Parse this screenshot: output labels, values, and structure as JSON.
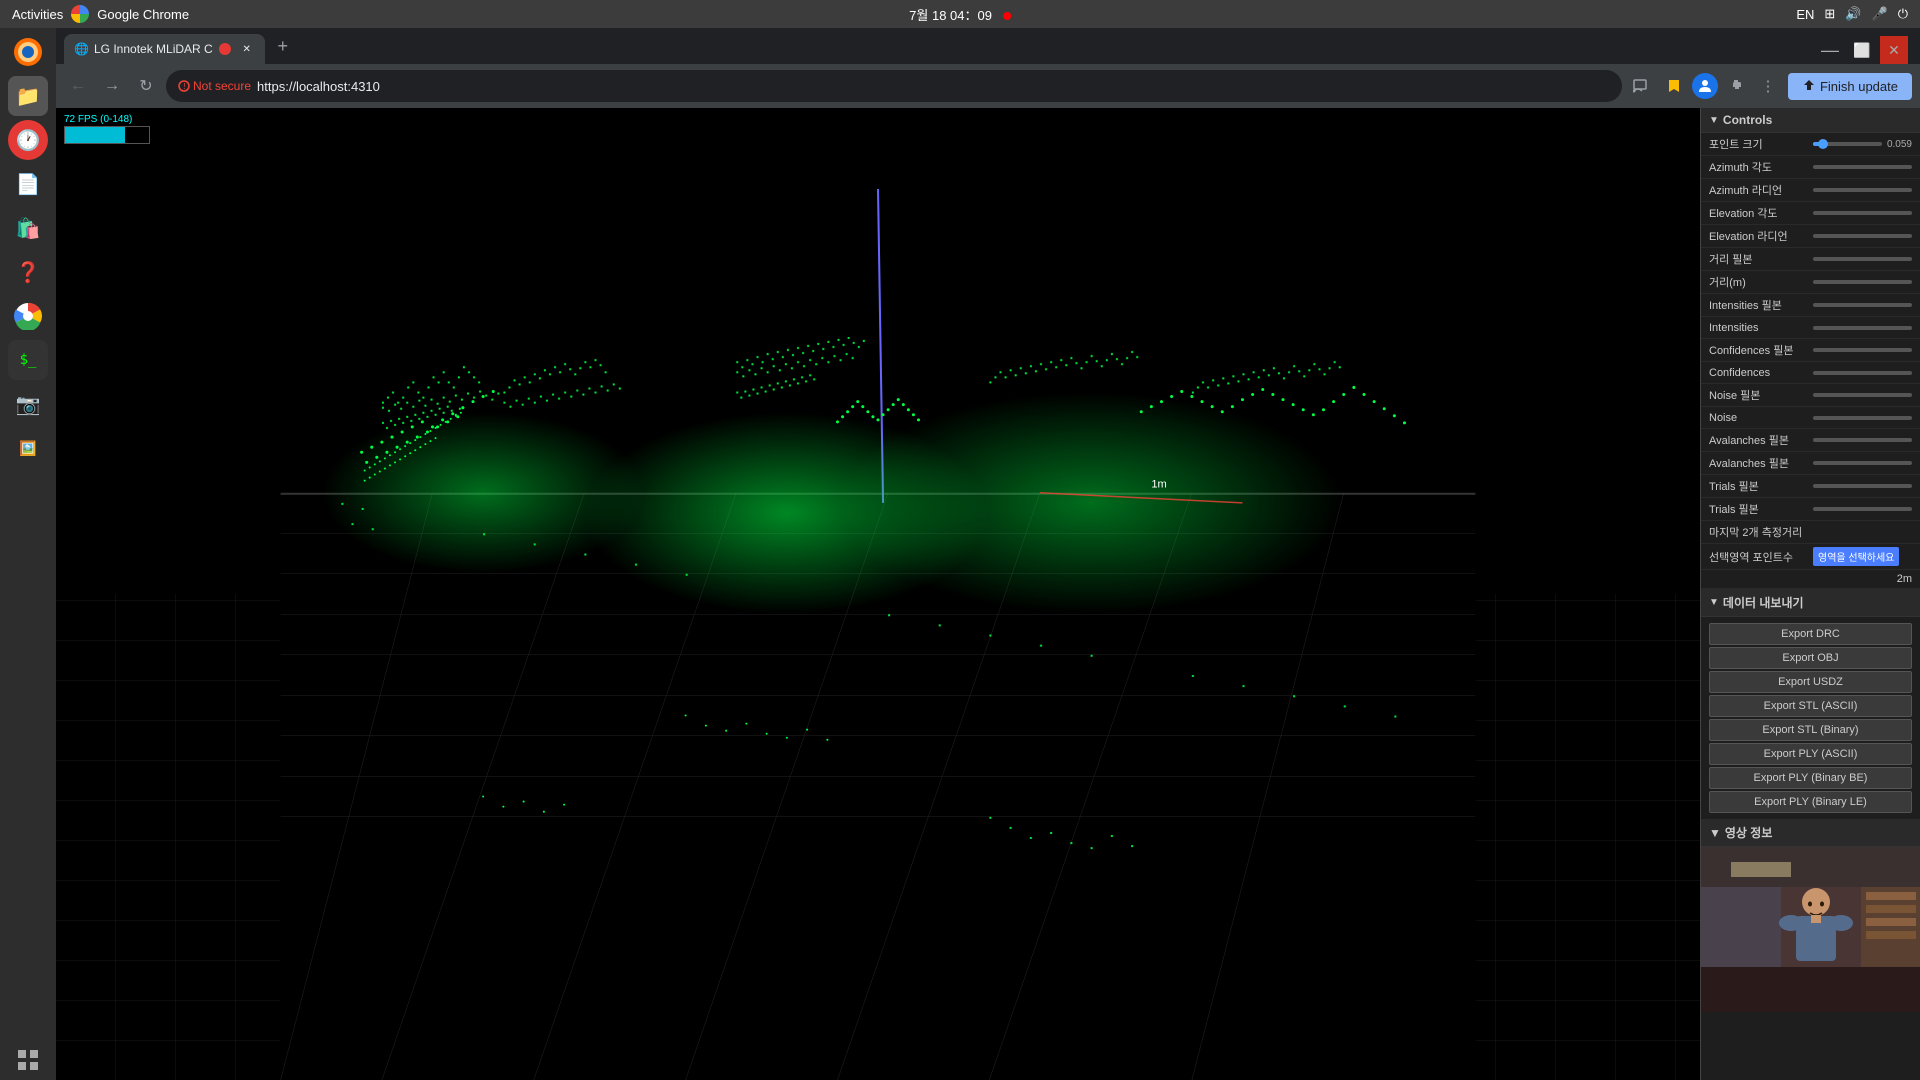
{
  "os": {
    "topbar_left": "Activities",
    "app_name": "Google Chrome",
    "datetime": "7월 18 04：09",
    "record_visible": true,
    "lang": "EN"
  },
  "browser": {
    "tab_title": "LG Innotek MLiDAR C",
    "tab_favicon": "🌐",
    "url": "https://localhost:4310",
    "not_secure_label": "Not secure",
    "finish_update_label": "Finish update",
    "new_tab_label": "+"
  },
  "viewport": {
    "fps_label": "72 FPS (0-148)",
    "distance_label": "1m",
    "distance_grid": "2m"
  },
  "controls": {
    "section_title": "Controls",
    "rows": [
      {
        "label": "포인트 크기",
        "has_slider": true,
        "fill_pct": 15,
        "value": "0.059"
      },
      {
        "label": "Azimuth 각도",
        "has_slider": true,
        "fill_pct": 0,
        "value": ""
      },
      {
        "label": "Azimuth 라디언",
        "has_slider": true,
        "fill_pct": 0,
        "value": ""
      },
      {
        "label": "Elevation 각도",
        "has_slider": true,
        "fill_pct": 0,
        "value": ""
      },
      {
        "label": "Elevation 라디언",
        "has_slider": true,
        "fill_pct": 0,
        "value": ""
      },
      {
        "label": "거리 필본",
        "has_slider": true,
        "fill_pct": 0,
        "value": ""
      },
      {
        "label": "거리(m)",
        "has_slider": true,
        "fill_pct": 0,
        "value": ""
      },
      {
        "label": "Intensities 필본",
        "has_slider": true,
        "fill_pct": 0,
        "value": ""
      },
      {
        "label": "Intensities",
        "has_slider": true,
        "fill_pct": 0,
        "value": ""
      },
      {
        "label": "Confidences 필본",
        "has_slider": true,
        "fill_pct": 0,
        "value": ""
      },
      {
        "label": "Confidences",
        "has_slider": true,
        "fill_pct": 0,
        "value": ""
      },
      {
        "label": "Noise 필본",
        "has_slider": true,
        "fill_pct": 0,
        "value": ""
      },
      {
        "label": "Noise",
        "has_slider": true,
        "fill_pct": 0,
        "value": ""
      },
      {
        "label": "Avalanches 필본",
        "has_slider": true,
        "fill_pct": 0,
        "value": ""
      },
      {
        "label": "Avalanches 필본",
        "has_slider": true,
        "fill_pct": 0,
        "value": ""
      },
      {
        "label": "Trials 필본",
        "has_slider": true,
        "fill_pct": 0,
        "value": ""
      },
      {
        "label": "Trials 필본",
        "has_slider": true,
        "fill_pct": 0,
        "value": ""
      },
      {
        "label": "마지막 2개 측정거리",
        "has_slider": false,
        "value": ""
      },
      {
        "label": "선택영역 포인트수",
        "has_slider": false,
        "value": "",
        "has_btn": true,
        "btn_label": "영역을 선택하세요"
      }
    ],
    "distance_value": "2m",
    "data_section_title": "데이터 내보내기",
    "export_buttons": [
      "Export DRC",
      "Export OBJ",
      "Export USDZ",
      "Export STL (ASCII)",
      "Export STL (Binary)",
      "Export PLY (ASCII)",
      "Export PLY (Binary BE)",
      "Export PLY (Binary LE)"
    ],
    "video_section_title": "영상 정보"
  }
}
